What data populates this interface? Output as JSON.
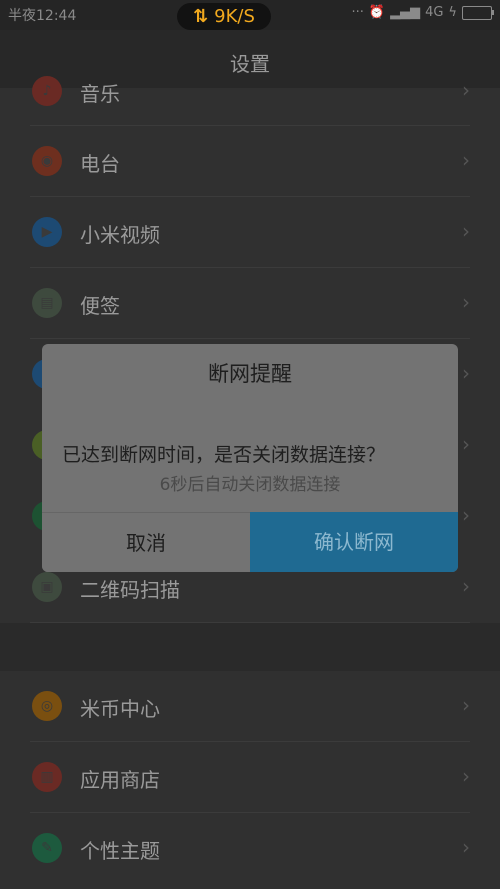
{
  "status_bar": {
    "time": "半夜12:44",
    "net_speed": "9K/S",
    "network": "4G",
    "icons": [
      "dots-icon",
      "alarm-icon",
      "wifi-off-icon",
      "signal-icon",
      "battery-icon"
    ]
  },
  "header": {
    "title": "设置"
  },
  "list": {
    "items": [
      {
        "label": "音乐",
        "icon": "music-icon",
        "color": "#c0392b"
      },
      {
        "label": "电台",
        "icon": "radio-icon",
        "color": "#d9441e"
      },
      {
        "label": "小米视频",
        "icon": "video-icon",
        "color": "#1f73c4"
      },
      {
        "label": "便签",
        "icon": "notes-icon",
        "color": "#556b55"
      },
      {
        "label": "",
        "icon": "blue-app-icon",
        "color": "#1f73c4"
      },
      {
        "label": "",
        "icon": "green-app-icon",
        "color": "#6b8f2a"
      },
      {
        "label": "",
        "icon": "green-app-icon-2",
        "color": "#1f7a3d"
      },
      {
        "label": "二维码扫描",
        "icon": "qr-scan-icon",
        "color": "#556b55"
      },
      {
        "label": "米币中心",
        "icon": "mi-coin-icon",
        "color": "#c87a10"
      },
      {
        "label": "应用商店",
        "icon": "app-store-icon",
        "color": "#c0392b"
      },
      {
        "label": "个性主题",
        "icon": "theme-icon",
        "color": "#1f8a5b"
      }
    ]
  },
  "dialog": {
    "title": "断网提醒",
    "message": "已达到断网时间，是否关闭数据连接？",
    "countdown": "6秒后自动关闭数据连接",
    "cancel_label": "取消",
    "confirm_label": "确认断网"
  }
}
